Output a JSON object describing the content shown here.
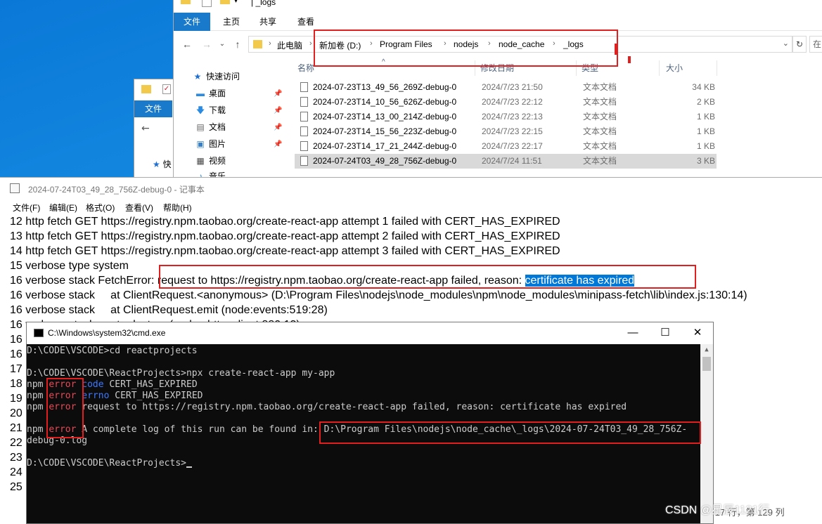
{
  "explorer_back": {
    "file_tab": "文件",
    "quick_access": "快"
  },
  "explorer": {
    "title": "_logs",
    "ribbon": {
      "file": "文件",
      "home": "主页",
      "share": "共享",
      "view": "查看"
    },
    "breadcrumb": [
      "此电脑",
      "新加卷 (D:)",
      "Program Files",
      "nodejs",
      "node_cache",
      "_logs"
    ],
    "search_partial": "在",
    "sidebar": {
      "quick_access": "快速访问",
      "items": [
        {
          "label": "桌面",
          "icon": "desktop-icon"
        },
        {
          "label": "下载",
          "icon": "download-icon"
        },
        {
          "label": "文档",
          "icon": "document-icon"
        },
        {
          "label": "图片",
          "icon": "picture-icon"
        },
        {
          "label": "视频",
          "icon": "video-icon"
        },
        {
          "label": "音乐",
          "icon": "music-icon"
        }
      ]
    },
    "columns": {
      "name": "名称",
      "date": "修改日期",
      "type": "类型",
      "size": "大小"
    },
    "files": [
      {
        "name": "2024-07-23T13_49_56_269Z-debug-0",
        "date": "2024/7/23 21:50",
        "type": "文本文档",
        "size": "34 KB"
      },
      {
        "name": "2024-07-23T14_10_56_626Z-debug-0",
        "date": "2024/7/23 22:12",
        "type": "文本文档",
        "size": "2 KB"
      },
      {
        "name": "2024-07-23T14_13_00_214Z-debug-0",
        "date": "2024/7/23 22:13",
        "type": "文本文档",
        "size": "1 KB"
      },
      {
        "name": "2024-07-23T14_15_56_223Z-debug-0",
        "date": "2024/7/23 22:15",
        "type": "文本文档",
        "size": "1 KB"
      },
      {
        "name": "2024-07-23T14_17_21_244Z-debug-0",
        "date": "2024/7/23 22:17",
        "type": "文本文档",
        "size": "1 KB"
      },
      {
        "name": "2024-07-24T03_49_28_756Z-debug-0",
        "date": "2024/7/24 11:51",
        "type": "文本文档",
        "size": "3 KB"
      }
    ]
  },
  "notepad": {
    "title": "2024-07-24T03_49_28_756Z-debug-0 - 记事本",
    "menu": [
      "文件(F)",
      "编辑(E)",
      "格式(O)",
      "查看(V)",
      "帮助(H)"
    ],
    "lines": [
      "12 http fetch GET https://registry.npm.taobao.org/create-react-app attempt 1 failed with CERT_HAS_EXPIRED",
      "13 http fetch GET https://registry.npm.taobao.org/create-react-app attempt 2 failed with CERT_HAS_EXPIRED",
      "14 http fetch GET https://registry.npm.taobao.org/create-react-app attempt 3 failed with CERT_HAS_EXPIRED",
      "15 verbose type system"
    ],
    "line16_prefix": "16 verbose stack FetchError: request to https://registry.npm.taobao.org/create-react-app failed, reason: ",
    "line16_highlight": "certificate has expired",
    "lines_after": [
      "16 verbose stack     at ClientRequest.<anonymous> (D:\\Program Files\\nodejs\\node_modules\\npm\\node_modules\\minipass-fetch\\lib\\index.js:130:14)",
      "16 verbose stack     at ClientRequest.emit (node:events:519:28)",
      "16 verbose stack     at _destroy (node:_http_client:880:13)",
      "16",
      "16",
      "17",
      "18",
      "19",
      "20",
      "21",
      "22",
      "23",
      "24",
      "25"
    ],
    "status": "第 17 行，第 129 列"
  },
  "cmd": {
    "title": "C:\\Windows\\system32\\cmd.exe",
    "lines": [
      {
        "parts": [
          {
            "t": "D:\\CODE\\VSCODE>cd reactprojects",
            "c": ""
          }
        ]
      },
      {
        "parts": []
      },
      {
        "parts": [
          {
            "t": "D:\\CODE\\VSCODE\\ReactProjects>npx create-react-app my-app",
            "c": ""
          }
        ]
      },
      {
        "parts": [
          {
            "t": "npm ",
            "c": ""
          },
          {
            "t": "error",
            "c": "err"
          },
          {
            "t": " ",
            "c": ""
          },
          {
            "t": "code",
            "c": "blu"
          },
          {
            "t": " CERT_HAS_EXPIRED",
            "c": ""
          }
        ]
      },
      {
        "parts": [
          {
            "t": "npm ",
            "c": ""
          },
          {
            "t": "error",
            "c": "err"
          },
          {
            "t": " ",
            "c": ""
          },
          {
            "t": "errno",
            "c": "blu"
          },
          {
            "t": " CERT_HAS_EXPIRED",
            "c": ""
          }
        ]
      },
      {
        "parts": [
          {
            "t": "npm ",
            "c": ""
          },
          {
            "t": "error",
            "c": "err"
          },
          {
            "t": " request to https://registry.npm.taobao.org/create-react-app failed, reason: certificate has expired",
            "c": ""
          }
        ]
      },
      {
        "parts": []
      },
      {
        "parts": [
          {
            "t": "npm ",
            "c": ""
          },
          {
            "t": "error",
            "c": "err"
          },
          {
            "t": " A complete log of this run can be found in: D:\\Program Files\\nodejs\\node_cache\\_logs\\2024-07-24T03_49_28_756Z-",
            "c": ""
          }
        ]
      },
      {
        "parts": [
          {
            "t": "debug-0.log",
            "c": ""
          }
        ]
      },
      {
        "parts": []
      },
      {
        "parts": [
          {
            "t": "D:\\CODE\\VSCODE\\ReactProjects>",
            "c": ""
          }
        ]
      }
    ]
  },
  "watermark": "CSDN @星辰1121行",
  "colors": {
    "desktop": "#1b96e8",
    "file_tab": "#1979ca",
    "highlight": "#0078d7",
    "annotation_red": "#e02020",
    "cmd_bg": "#0c0c0c",
    "cmd_error": "#e74856",
    "cmd_keyword": "#3b78ff"
  }
}
